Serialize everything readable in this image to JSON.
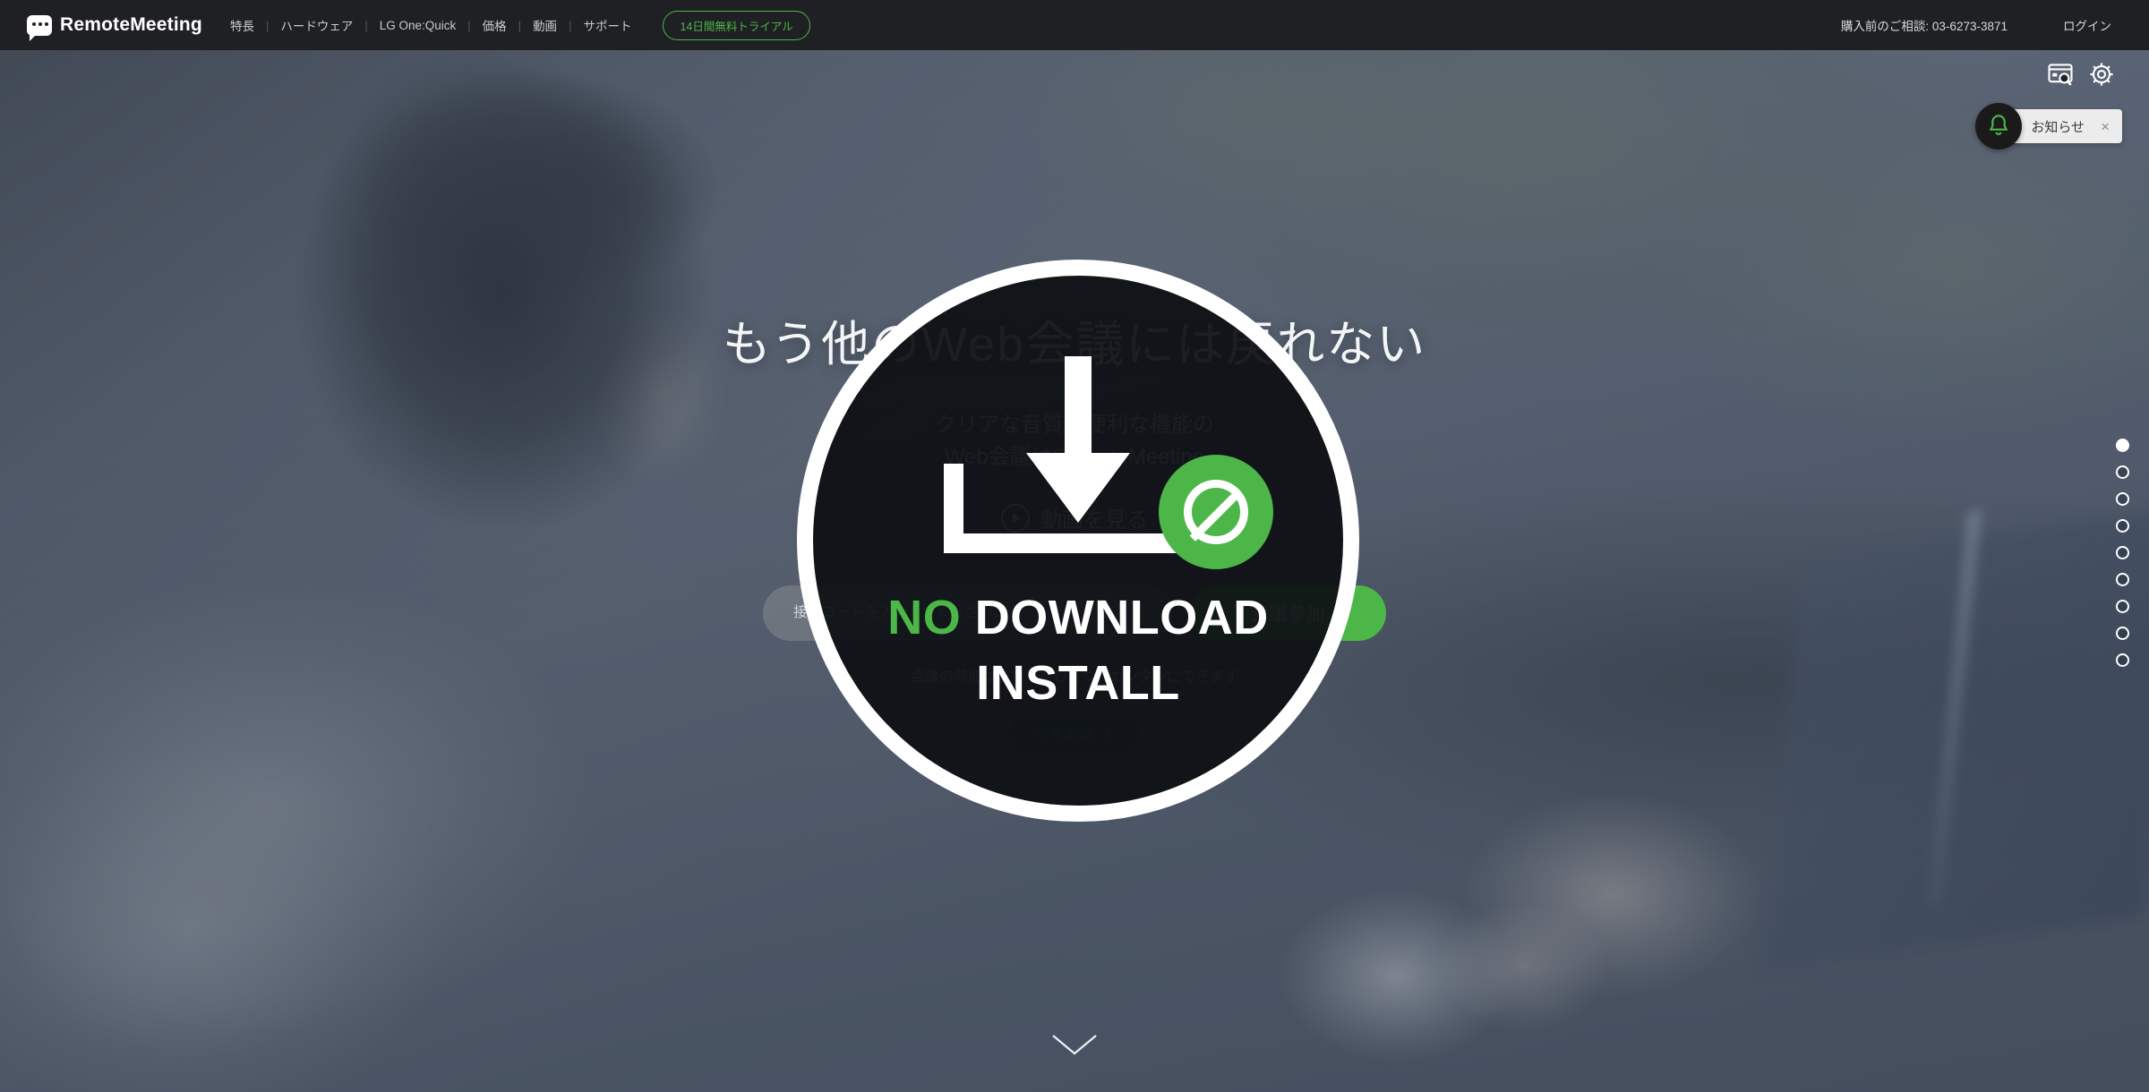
{
  "brand": {
    "name": "RemoteMeeting",
    "icon": "chat-bubble-icon"
  },
  "nav": {
    "items": [
      {
        "label": "特長"
      },
      {
        "label": "ハードウェア"
      },
      {
        "label": "LG One:Quick"
      },
      {
        "label": "価格"
      },
      {
        "label": "動画"
      },
      {
        "label": "サポート"
      }
    ],
    "separator": "|",
    "trial_label": "14日間無料トライアル",
    "phone_label": "購入前のご相談: 03-6273-3871",
    "login_label": "ログイン"
  },
  "tools": {
    "capture_icon": "screenshot-search-icon",
    "settings_icon": "gear-icon"
  },
  "notification": {
    "bell_icon": "bell-icon",
    "label": "お知らせ",
    "close_label": "×"
  },
  "hero": {
    "title": "もう他のWeb会議には戻れない",
    "subtitle_line1": "クリアな音質と便利な機能の",
    "subtitle_line2": "Web会議はRemoteMeeting",
    "video_button_label": "動画を見る",
    "video_icon": "play-circle-icon",
    "code_placeholder": "接続コードを入力してください。",
    "code_value": "",
    "join_button_label": "会議参加",
    "join_note": "会議の参加はクリックひとつ、カンタンにできます",
    "demo_button_label": "デモ申請",
    "demo_icon": "chevron-right-icon"
  },
  "overlay": {
    "download_icon": "download-icon",
    "ban_icon": "no-entry-icon",
    "text_no": "NO",
    "text_download": "DOWNLOAD",
    "text_install": "INSTALL"
  },
  "slider": {
    "dots": [
      {
        "active": true
      },
      {
        "active": false
      },
      {
        "active": false
      },
      {
        "active": false
      },
      {
        "active": false
      },
      {
        "active": false
      },
      {
        "active": false
      },
      {
        "active": false
      },
      {
        "active": false
      }
    ],
    "scroll_icon": "chevron-down-icon"
  },
  "colors": {
    "accent_green": "#4cb648",
    "topbar_bg": "#1f2023",
    "overlay_bg": "#0e1014",
    "notify_bg": "#ececec"
  }
}
